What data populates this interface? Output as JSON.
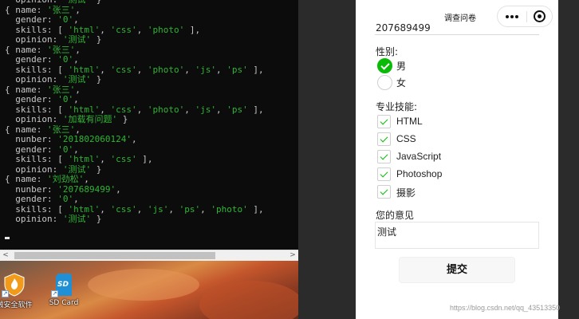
{
  "terminal": {
    "lines": [
      [
        {
          "t": "  opinion: "
        },
        {
          "t": "'测试'",
          "s": 1
        },
        {
          "t": " }"
        }
      ],
      [
        {
          "t": "{ name: "
        },
        {
          "t": "'张三'",
          "s": 1
        },
        {
          "t": ","
        }
      ],
      [
        {
          "t": "  gender: "
        },
        {
          "t": "'0'",
          "s": 1
        },
        {
          "t": ","
        }
      ],
      [
        {
          "t": "  skills: [ "
        },
        {
          "t": "'html'",
          "s": 1
        },
        {
          "t": ", "
        },
        {
          "t": "'css'",
          "s": 1
        },
        {
          "t": ", "
        },
        {
          "t": "'photo'",
          "s": 1
        },
        {
          "t": " ],"
        }
      ],
      [
        {
          "t": "  opinion: "
        },
        {
          "t": "'测试'",
          "s": 1
        },
        {
          "t": " }"
        }
      ],
      [
        {
          "t": "{ name: "
        },
        {
          "t": "'张三'",
          "s": 1
        },
        {
          "t": ","
        }
      ],
      [
        {
          "t": "  gender: "
        },
        {
          "t": "'0'",
          "s": 1
        },
        {
          "t": ","
        }
      ],
      [
        {
          "t": "  skills: [ "
        },
        {
          "t": "'html'",
          "s": 1
        },
        {
          "t": ", "
        },
        {
          "t": "'css'",
          "s": 1
        },
        {
          "t": ", "
        },
        {
          "t": "'photo'",
          "s": 1
        },
        {
          "t": ", "
        },
        {
          "t": "'js'",
          "s": 1
        },
        {
          "t": ", "
        },
        {
          "t": "'ps'",
          "s": 1
        },
        {
          "t": " ],"
        }
      ],
      [
        {
          "t": "  opinion: "
        },
        {
          "t": "'测试'",
          "s": 1
        },
        {
          "t": " }"
        }
      ],
      [
        {
          "t": "{ name: "
        },
        {
          "t": "'张三'",
          "s": 1
        },
        {
          "t": ","
        }
      ],
      [
        {
          "t": "  gender: "
        },
        {
          "t": "'0'",
          "s": 1
        },
        {
          "t": ","
        }
      ],
      [
        {
          "t": "  skills: [ "
        },
        {
          "t": "'html'",
          "s": 1
        },
        {
          "t": ", "
        },
        {
          "t": "'css'",
          "s": 1
        },
        {
          "t": ", "
        },
        {
          "t": "'photo'",
          "s": 1
        },
        {
          "t": ", "
        },
        {
          "t": "'js'",
          "s": 1
        },
        {
          "t": ", "
        },
        {
          "t": "'ps'",
          "s": 1
        },
        {
          "t": " ],"
        }
      ],
      [
        {
          "t": "  opinion: "
        },
        {
          "t": "'加载有问题'",
          "s": 1
        },
        {
          "t": " }"
        }
      ],
      [
        {
          "t": "{ name: "
        },
        {
          "t": "'张三'",
          "s": 1
        },
        {
          "t": ","
        }
      ],
      [
        {
          "t": "  nunber: "
        },
        {
          "t": "'201802060124'",
          "s": 1
        },
        {
          "t": ","
        }
      ],
      [
        {
          "t": "  gender: "
        },
        {
          "t": "'0'",
          "s": 1
        },
        {
          "t": ","
        }
      ],
      [
        {
          "t": "  skills: [ "
        },
        {
          "t": "'html'",
          "s": 1
        },
        {
          "t": ", "
        },
        {
          "t": "'css'",
          "s": 1
        },
        {
          "t": " ],"
        }
      ],
      [
        {
          "t": "  opinion: "
        },
        {
          "t": "'测试'",
          "s": 1
        },
        {
          "t": " }"
        }
      ],
      [
        {
          "t": "{ name: "
        },
        {
          "t": "'刘劲松'",
          "s": 1
        },
        {
          "t": ","
        }
      ],
      [
        {
          "t": "  nunber: "
        },
        {
          "t": "'207689499'",
          "s": 1
        },
        {
          "t": ","
        }
      ],
      [
        {
          "t": "  gender: "
        },
        {
          "t": "'0'",
          "s": 1
        },
        {
          "t": ","
        }
      ],
      [
        {
          "t": "  skills: [ "
        },
        {
          "t": "'html'",
          "s": 1
        },
        {
          "t": ", "
        },
        {
          "t": "'css'",
          "s": 1
        },
        {
          "t": ", "
        },
        {
          "t": "'js'",
          "s": 1
        },
        {
          "t": ", "
        },
        {
          "t": "'ps'",
          "s": 1
        },
        {
          "t": ", "
        },
        {
          "t": "'photo'",
          "s": 1
        },
        {
          "t": " ],"
        }
      ],
      [
        {
          "t": "  opinion: "
        },
        {
          "t": "'测试'",
          "s": 1
        },
        {
          "t": " }"
        }
      ]
    ],
    "string_color": "#2fb534",
    "text_color": "#c8c8c8"
  },
  "scrollbar": {
    "left_arrow": "<",
    "right_arrow": ">"
  },
  "desktop": {
    "icons": [
      {
        "name": "security-software-icon",
        "label": "绒安全软件"
      },
      {
        "name": "sd-card-icon",
        "label": "SD Card",
        "glyph": "SD"
      }
    ]
  },
  "miniprogram": {
    "nav_title": "调查问卷",
    "number_value": "207689499",
    "gender_label": "性别:",
    "gender_options": [
      {
        "label": "男",
        "checked": true
      },
      {
        "label": "女",
        "checked": false
      }
    ],
    "skills_label": "专业技能:",
    "skills": [
      {
        "label": "HTML",
        "checked": true
      },
      {
        "label": "CSS",
        "checked": true
      },
      {
        "label": "JavaScript",
        "checked": true
      },
      {
        "label": "Photoshop",
        "checked": true
      },
      {
        "label": "摄影",
        "checked": true
      }
    ],
    "opinion_label": "您的意见",
    "opinion_value": "测试",
    "submit_label": "提交",
    "accent_color": "#09bb07"
  },
  "watermark": "https://blog.csdn.net/qq_43513350"
}
